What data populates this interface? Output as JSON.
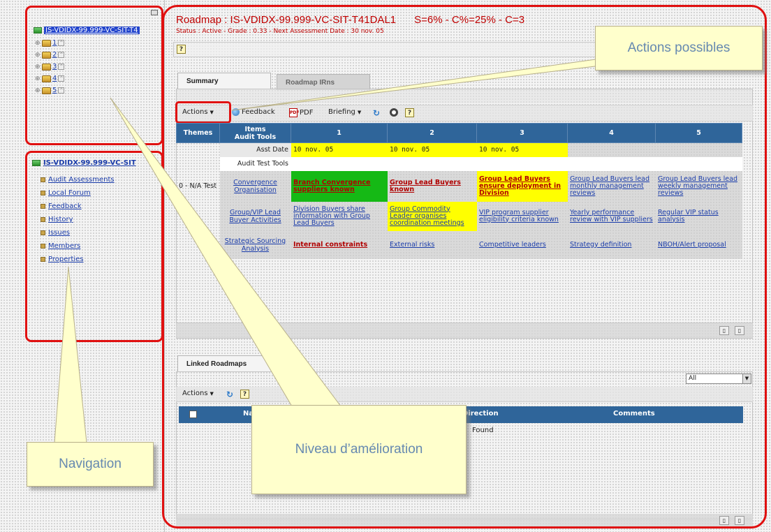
{
  "tree": {
    "root_label": "IS-VDIDX-99.999-VC-SIT-T4",
    "items": [
      "1",
      "2",
      "3",
      "4",
      "5"
    ]
  },
  "nav": {
    "root_label": "IS-VDIDX-99.999-VC-SIT",
    "links": [
      "Audit Assessments",
      "Local Forum",
      "Feedback",
      "History",
      "Issues",
      "Members",
      "Properties"
    ]
  },
  "header": {
    "title": "Roadmap : IS-VDIDX-99.999-VC-SIT-T41DAL1",
    "score": "S=6% - C%=25% - C=3",
    "status": "Status : Active - Grade : 0.33 - Next Assessment Date : 30 nov. 05"
  },
  "tabs": {
    "summary": "Summary",
    "irns": "Roadmap IRns",
    "linked": "Linked Roadmaps"
  },
  "toolbar": {
    "actions": "Actions",
    "feedback": "Feedback",
    "pdf": "PDF",
    "pdf_icon": "PDF",
    "briefing": "Briefing",
    "help": "?"
  },
  "matrix": {
    "themes_header": "Themes",
    "items_header": "Items\nAudit Tools",
    "levels": [
      "1",
      "2",
      "3",
      "4",
      "5"
    ],
    "asst_date_label": "Asst Date",
    "asst_dates": [
      "10 nov. 05",
      "10 nov. 05",
      "10 nov. 05",
      "",
      ""
    ],
    "audit_tools_label": "Audit Test Tools",
    "theme_label": "0 - N/A Test",
    "rows": [
      {
        "tool": "Convergence Organisation",
        "cells": [
          "Branch Convergence suppliers known",
          "Group Lead Buyers known",
          "Group Lead Buyers ensure deployment in Division",
          "Group Lead Buyers lead monthly management reviews",
          "Group Lead Buyers lead weekly management reviews"
        ]
      },
      {
        "tool": "Group/VIP Lead Buyer Activities",
        "cells": [
          "Division Buyers share information with Group Lead Buyers",
          "Group Commodity Leader organises coordination meetings",
          "VIP program supplier eligibility criteria known",
          "Yearly performance review with VIP suppliers",
          "Regular VIP status analysis"
        ]
      },
      {
        "tool": "Strategic Sourcing Analysis",
        "cells": [
          "Internal constraints",
          "External risks",
          "Competitive leaders",
          "Strategy definition",
          "NBOH/Alert proposal"
        ]
      }
    ]
  },
  "linked": {
    "filter_value": "All",
    "actions": "Actions",
    "col_name": "Na",
    "col_direction": "Direction",
    "col_comments": "Comments",
    "empty_text": "Found"
  },
  "callouts": {
    "actions": "Actions possibles",
    "navigation": "Navigation",
    "level": "Niveau d’amélioration"
  },
  "colors": {
    "annotation_red": "#e01010",
    "header_blue": "#2f659a",
    "done_green": "#15b915",
    "current_yellow": "#ffff00",
    "title_red": "#c00000",
    "callout_fill": "#ffffcc"
  }
}
